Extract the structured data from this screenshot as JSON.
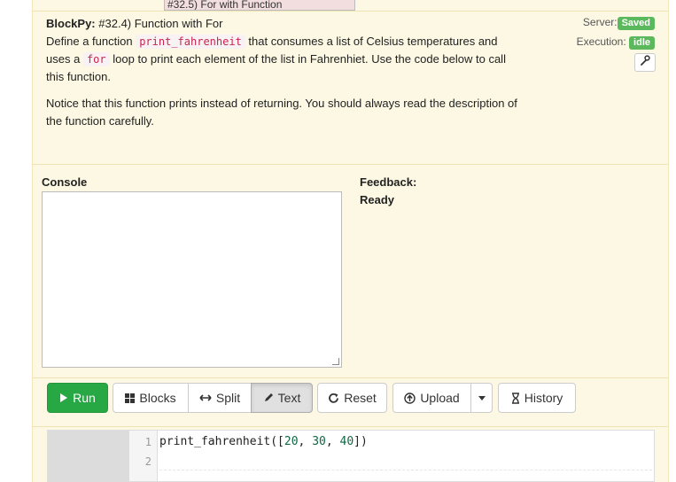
{
  "top_tab": {
    "label": "#32.5) For with Function"
  },
  "problem": {
    "brand": "BlockPy:",
    "title": "#32.4) Function with For",
    "p1_a": "Define a function",
    "p1_code1": "print_fahrenheit",
    "p1_b": "that consumes a list of Celsius temperatures and uses a",
    "p1_code2": "for",
    "p1_c": "loop to print each element of the list in Fahrenhiet. Use the code below to call this function.",
    "p2": "Notice that this function prints instead of returning. You should always read the description of the function carefully."
  },
  "status": {
    "server_label": "Server:",
    "server_value": "Saved",
    "execution_label": "Execution:",
    "execution_value": "idle",
    "badge_color": "#5cb85c"
  },
  "console": {
    "label": "Console",
    "content": ""
  },
  "feedback": {
    "label": "Feedback:",
    "status": "Ready"
  },
  "toolbar": {
    "run": "Run",
    "blocks": "Blocks",
    "split": "Split",
    "text": "Text",
    "reset": "Reset",
    "upload": "Upload",
    "history": "History",
    "active_mode": "Text",
    "run_color": "#28a745"
  },
  "editor": {
    "line_numbers": [
      "1",
      "2"
    ],
    "code": {
      "fn": "print_fahrenheit([",
      "n1": "20",
      "s1": ", ",
      "n2": "30",
      "s2": ", ",
      "n3": "40",
      "end": "])"
    }
  }
}
